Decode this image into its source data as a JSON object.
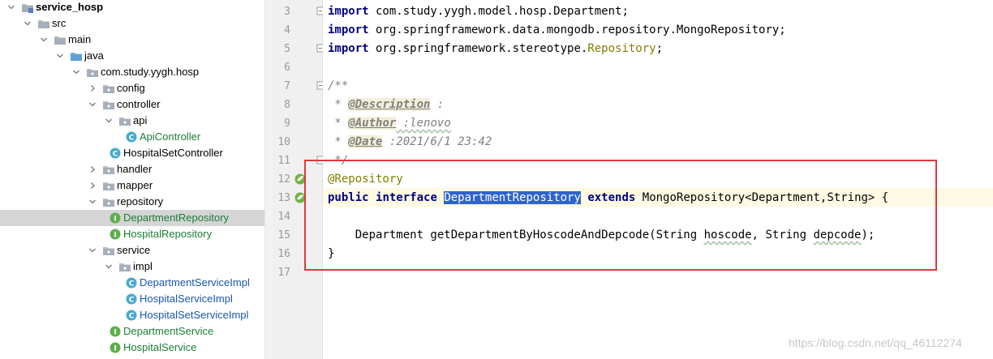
{
  "tree": {
    "rows": [
      {
        "label": "service_hosp",
        "type": "module",
        "arrow": "down",
        "depth": 0,
        "bold": true
      },
      {
        "label": "src",
        "type": "folder",
        "arrow": "down",
        "depth": 1
      },
      {
        "label": "main",
        "type": "folder",
        "arrow": "down",
        "depth": 2
      },
      {
        "label": "java",
        "type": "source-folder",
        "arrow": "down",
        "depth": 3
      },
      {
        "label": "com.study.yygh.hosp",
        "type": "package",
        "arrow": "down",
        "depth": 4
      },
      {
        "label": "config",
        "type": "package",
        "arrow": "right",
        "depth": 5
      },
      {
        "label": "controller",
        "type": "package",
        "arrow": "down",
        "depth": 5
      },
      {
        "label": "api",
        "type": "package",
        "arrow": "down",
        "depth": 6
      },
      {
        "label": "ApiController",
        "type": "class",
        "arrow": "none",
        "depth": 7,
        "color": "green"
      },
      {
        "label": "HospitalSetController",
        "type": "class",
        "arrow": "none",
        "depth": 6
      },
      {
        "label": "handler",
        "type": "package",
        "arrow": "right",
        "depth": 5
      },
      {
        "label": "mapper",
        "type": "package",
        "arrow": "right",
        "depth": 5
      },
      {
        "label": "repository",
        "type": "package",
        "arrow": "down",
        "depth": 5
      },
      {
        "label": "DepartmentRepository",
        "type": "interface",
        "arrow": "none",
        "depth": 6,
        "color": "green",
        "selected": true
      },
      {
        "label": "HospitalRepository",
        "type": "interface",
        "arrow": "none",
        "depth": 6,
        "color": "green"
      },
      {
        "label": "service",
        "type": "package",
        "arrow": "down",
        "depth": 5
      },
      {
        "label": "impl",
        "type": "package",
        "arrow": "down",
        "depth": 6
      },
      {
        "label": "DepartmentServiceImpl",
        "type": "class",
        "arrow": "none",
        "depth": 7,
        "color": "blue"
      },
      {
        "label": "HospitalServiceImpl",
        "type": "class",
        "arrow": "none",
        "depth": 7,
        "color": "blue"
      },
      {
        "label": "HospitalSetServiceImpl",
        "type": "class",
        "arrow": "none",
        "depth": 7,
        "color": "blue"
      },
      {
        "label": "DepartmentService",
        "type": "interface",
        "arrow": "none",
        "depth": 6,
        "color": "green"
      },
      {
        "label": "HospitalService",
        "type": "interface",
        "arrow": "none",
        "depth": 6,
        "color": "green"
      }
    ]
  },
  "editor": {
    "line_numbers": [
      "3",
      "4",
      "5",
      "6",
      "7",
      "8",
      "9",
      "10",
      "11",
      "12",
      "13",
      "14",
      "15",
      "16",
      "17"
    ],
    "code": {
      "l3_kw": "import",
      "l3_rest": " com.study.yygh.model.hosp.Department;",
      "l4_kw": "import",
      "l4_rest": " org.springframework.data.mongodb.repository.MongoRepository;",
      "l5_kw": "import",
      "l5_pkg": " org.springframework.stereotype.",
      "l5_cls": "Repository",
      "l5_end": ";",
      "l7": "/**",
      "l8_star": " * ",
      "l8_tag": "@Description",
      "l8_rest": " :",
      "l9_star": " * ",
      "l9_tag": "@Author",
      "l9_rest": " :lenovo",
      "l10_star": " * ",
      "l10_tag": "@Date",
      "l10_rest": " :2021/6/1 23:42",
      "l11": " */",
      "l12": "@Repository",
      "l13_kw1": "public",
      "l13_kw2": "interface",
      "l13_name": "DepartmentRepository",
      "l13_kw3": "extends",
      "l13_rest": " MongoRepository<Department,String> {",
      "l15_a": "    Department getDepartmentByHoscodeAndDepcode(String ",
      "l15_b": "hoscode",
      "l15_c": ", String ",
      "l15_d": "depcode",
      "l15_e": ");",
      "l16": "}"
    }
  },
  "watermark": "https://blog.csdn.net/qq_46112274",
  "colors": {
    "keyword": "#000080",
    "annotation": "#808000",
    "comment": "#808080",
    "selection": "#2f65ca",
    "highlight_box": "#e0393e",
    "tree_selection": "#d5d5d5"
  }
}
